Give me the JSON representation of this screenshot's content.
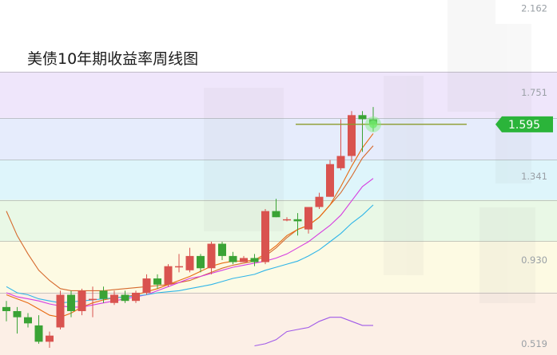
{
  "chart_data": {
    "type": "candlestick",
    "title": "美债10年期收益率周线图",
    "y_ticks": [
      {
        "value": 2.162,
        "label": "2.162"
      },
      {
        "value": 1.751,
        "label": "1.751"
      },
      {
        "value": 1.341,
        "label": "1.341"
      },
      {
        "value": 0.93,
        "label": "0.930"
      },
      {
        "value": 0.519,
        "label": "0.519"
      }
    ],
    "ylim": [
      0.465,
      2.204
    ],
    "current_price": {
      "value": 1.595,
      "label": "1.595"
    },
    "colors": {
      "up": "#d9534f",
      "down": "#3aa335",
      "price_tag": "#2bb43a",
      "price_line": "#8a9a2a",
      "ma_fast": "#d66a2e",
      "ma_mid": "#e86a10",
      "ma_slow": "#d63de0",
      "ma_slower": "#2fb5e8",
      "ma_slowest": "#a05ae8"
    },
    "background_bands": [
      {
        "from": 1.853,
        "to": 2.204,
        "color": "#ffffff"
      },
      {
        "from": 1.626,
        "to": 1.853,
        "color": "#efe6fb"
      },
      {
        "from": 1.421,
        "to": 1.626,
        "color": "#e6ecfc"
      },
      {
        "from": 1.225,
        "to": 1.421,
        "color": "#def5fb"
      },
      {
        "from": 1.022,
        "to": 1.225,
        "color": "#e9f8e6"
      },
      {
        "from": 0.771,
        "to": 1.022,
        "color": "#fdfae3"
      },
      {
        "from": 0.465,
        "to": 0.771,
        "color": "#fcefe6"
      }
    ],
    "candles": [
      {
        "o": 0.7,
        "h": 0.73,
        "l": 0.63,
        "c": 0.68
      },
      {
        "o": 0.68,
        "h": 0.7,
        "l": 0.57,
        "c": 0.65
      },
      {
        "o": 0.65,
        "h": 0.67,
        "l": 0.6,
        "c": 0.62
      },
      {
        "o": 0.61,
        "h": 0.66,
        "l": 0.52,
        "c": 0.53
      },
      {
        "o": 0.53,
        "h": 0.58,
        "l": 0.5,
        "c": 0.56
      },
      {
        "o": 0.6,
        "h": 0.78,
        "l": 0.59,
        "c": 0.76
      },
      {
        "o": 0.76,
        "h": 0.78,
        "l": 0.65,
        "c": 0.68
      },
      {
        "o": 0.68,
        "h": 0.79,
        "l": 0.66,
        "c": 0.78
      },
      {
        "o": 0.74,
        "h": 0.8,
        "l": 0.65,
        "c": 0.74
      },
      {
        "o": 0.78,
        "h": 0.8,
        "l": 0.72,
        "c": 0.74
      },
      {
        "o": 0.72,
        "h": 0.78,
        "l": 0.71,
        "c": 0.76
      },
      {
        "o": 0.76,
        "h": 0.78,
        "l": 0.72,
        "c": 0.73
      },
      {
        "o": 0.73,
        "h": 0.78,
        "l": 0.72,
        "c": 0.77
      },
      {
        "o": 0.77,
        "h": 0.86,
        "l": 0.76,
        "c": 0.84
      },
      {
        "o": 0.84,
        "h": 0.86,
        "l": 0.79,
        "c": 0.81
      },
      {
        "o": 0.81,
        "h": 0.91,
        "l": 0.8,
        "c": 0.9
      },
      {
        "o": 0.9,
        "h": 0.96,
        "l": 0.87,
        "c": 0.9
      },
      {
        "o": 0.88,
        "h": 0.99,
        "l": 0.87,
        "c": 0.95
      },
      {
        "o": 0.95,
        "h": 0.96,
        "l": 0.87,
        "c": 0.89
      },
      {
        "o": 0.89,
        "h": 1.02,
        "l": 0.86,
        "c": 1.01
      },
      {
        "o": 1.01,
        "h": 1.02,
        "l": 0.93,
        "c": 0.95
      },
      {
        "o": 0.95,
        "h": 0.97,
        "l": 0.91,
        "c": 0.92
      },
      {
        "o": 0.92,
        "h": 0.95,
        "l": 0.92,
        "c": 0.94
      },
      {
        "o": 0.94,
        "h": 0.96,
        "l": 0.9,
        "c": 0.92
      },
      {
        "o": 0.92,
        "h": 1.18,
        "l": 0.91,
        "c": 1.17
      },
      {
        "o": 1.17,
        "h": 1.23,
        "l": 1.14,
        "c": 1.14
      },
      {
        "o": 1.13,
        "h": 1.14,
        "l": 1.12,
        "c": 1.13
      },
      {
        "o": 1.13,
        "h": 1.16,
        "l": 1.05,
        "c": 1.12
      },
      {
        "o": 1.08,
        "h": 1.19,
        "l": 1.06,
        "c": 1.19
      },
      {
        "o": 1.19,
        "h": 1.26,
        "l": 1.18,
        "c": 1.24
      },
      {
        "o": 1.24,
        "h": 1.42,
        "l": 1.24,
        "c": 1.4
      },
      {
        "o": 1.38,
        "h": 1.62,
        "l": 1.37,
        "c": 1.44
      },
      {
        "o": 1.44,
        "h": 1.66,
        "l": 1.41,
        "c": 1.64
      },
      {
        "o": 1.64,
        "h": 1.66,
        "l": 1.46,
        "c": 1.62
      },
      {
        "o": 1.62,
        "h": 1.68,
        "l": 1.56,
        "c": 1.595
      }
    ],
    "ma_lines": [
      {
        "key": "ma_fast",
        "values": [
          1.17,
          1.05,
          0.96,
          0.88,
          0.83,
          0.79,
          0.78,
          0.78,
          0.78,
          0.78,
          0.785,
          0.79,
          0.795,
          0.8,
          0.805,
          0.81,
          0.82,
          0.83,
          0.85,
          0.87,
          0.89,
          0.905,
          0.915,
          0.925,
          0.95,
          0.99,
          1.04,
          1.08,
          1.1,
          1.14,
          1.2,
          1.26,
          1.34,
          1.43,
          1.49
        ]
      },
      {
        "key": "ma_mid",
        "values": [
          0.76,
          0.74,
          0.72,
          0.69,
          0.66,
          0.65,
          0.67,
          0.7,
          0.72,
          0.735,
          0.745,
          0.75,
          0.76,
          0.775,
          0.79,
          0.81,
          0.83,
          0.85,
          0.875,
          0.9,
          0.915,
          0.925,
          0.925,
          0.93,
          0.96,
          1.0,
          1.05,
          1.08,
          1.1,
          1.14,
          1.2,
          1.29,
          1.39,
          1.48,
          1.55
        ]
      },
      {
        "key": "ma_slow",
        "values": [
          0.77,
          0.75,
          0.74,
          0.73,
          0.715,
          0.705,
          0.7,
          0.7,
          0.71,
          0.72,
          0.73,
          0.74,
          0.75,
          0.76,
          0.78,
          0.8,
          0.82,
          0.84,
          0.85,
          0.865,
          0.88,
          0.895,
          0.905,
          0.915,
          0.925,
          0.94,
          0.96,
          0.99,
          1.02,
          1.06,
          1.1,
          1.15,
          1.22,
          1.29,
          1.33
        ]
      },
      {
        "key": "ma_slower",
        "values": [
          0.8,
          0.77,
          0.76,
          0.74,
          0.73,
          0.72,
          0.725,
          0.73,
          0.735,
          0.74,
          0.745,
          0.75,
          0.755,
          0.76,
          0.77,
          0.775,
          0.78,
          0.79,
          0.8,
          0.81,
          0.825,
          0.84,
          0.85,
          0.86,
          0.88,
          0.895,
          0.91,
          0.925,
          0.95,
          0.98,
          1.02,
          1.06,
          1.11,
          1.15,
          1.2
        ]
      },
      {
        "key": "ma_slowest",
        "values": [
          null,
          null,
          null,
          null,
          null,
          null,
          null,
          null,
          null,
          null,
          null,
          null,
          null,
          null,
          null,
          null,
          null,
          null,
          null,
          null,
          null,
          null,
          null,
          0.51,
          0.52,
          0.54,
          0.58,
          0.59,
          0.6,
          0.63,
          0.65,
          0.65,
          0.63,
          0.61,
          0.61
        ]
      }
    ]
  }
}
